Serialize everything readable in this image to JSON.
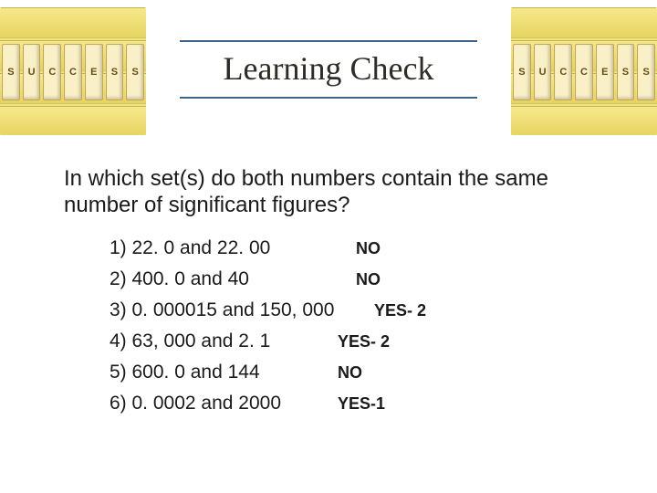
{
  "title": "Learning Check",
  "question": "In which set(s) do both numbers contain the same number of significant figures?",
  "dice_left": [
    "S",
    "U",
    "C",
    "C",
    "E",
    "S",
    "S"
  ],
  "dice_right": [
    "S",
    "U",
    "C",
    "C",
    "E",
    "S",
    "S"
  ],
  "items": [
    {
      "text": "1)  22. 0  and 22. 00",
      "answer": "NO"
    },
    {
      "text": "2)  400. 0 and 40",
      "answer": "NO"
    },
    {
      "text": "3)  0. 000015 and 150, 000",
      "answer": "YES- 2"
    },
    {
      "text": "4) 63, 000 and 2. 1",
      "answer": "YES- 2"
    },
    {
      "text": "5) 600. 0 and 144",
      "answer": "NO"
    },
    {
      "text": "6) 0. 0002 and 2000",
      "answer": "YES-1"
    }
  ]
}
